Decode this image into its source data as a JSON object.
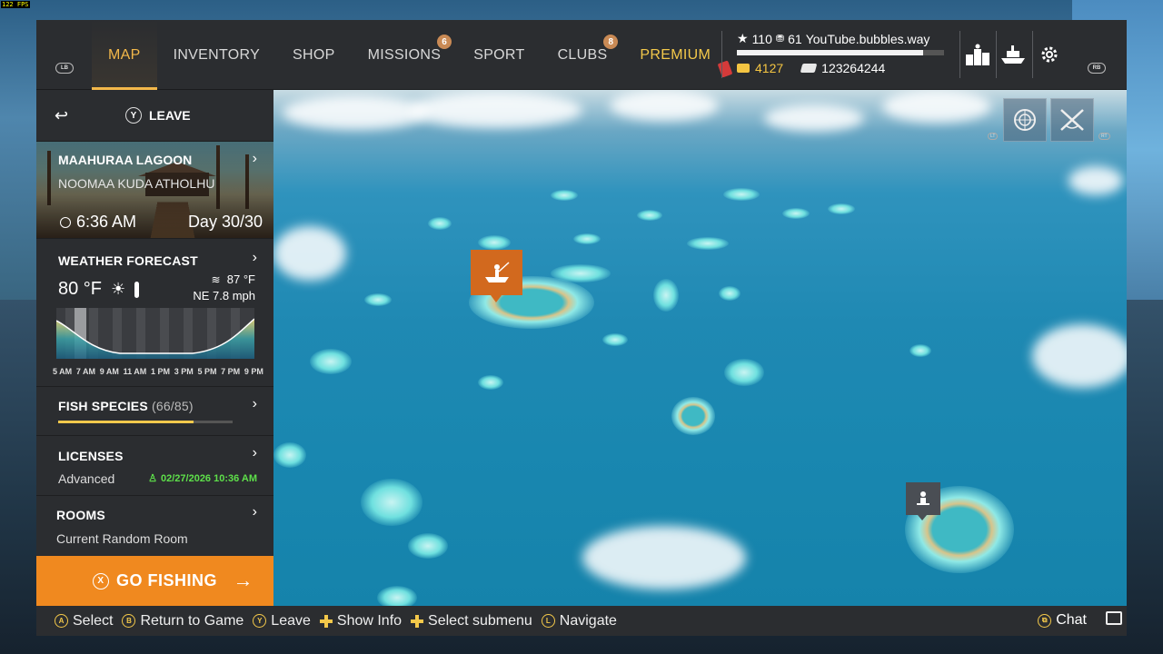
{
  "fps": "122 FPS",
  "topbar": {
    "lb": "LB",
    "rb": "RB",
    "nav": [
      {
        "label": "MAP",
        "badge": ""
      },
      {
        "label": "INVENTORY",
        "badge": ""
      },
      {
        "label": "SHOP",
        "badge": ""
      },
      {
        "label": "MISSIONS",
        "badge": "6"
      },
      {
        "label": "SPORT",
        "badge": ""
      },
      {
        "label": "CLUBS",
        "badge": "8"
      },
      {
        "label": "PREMIUM",
        "badge": ""
      }
    ],
    "player": {
      "level": "110",
      "rank": "61",
      "name": "YouTube.bubbles.way",
      "xp_progress": 0.9,
      "gold": "4127",
      "cash": "123264244"
    },
    "icons": [
      "leaderboard-icon",
      "ship-icon",
      "settings-icon"
    ]
  },
  "panel": {
    "leave_button": "Y",
    "leave_label": "LEAVE",
    "location": {
      "name": "MAAHURAA LAGOON",
      "region": "NOOMAA KUDA ATHOLHU",
      "time": "6:36 AM",
      "day": "Day 30/30"
    },
    "weather": {
      "title": "WEATHER FORECAST",
      "air_temp": "80 °F",
      "water_temp": "87 °F",
      "wind": "NE 7.8 mph",
      "hours": [
        "5 AM",
        "7 AM",
        "9 AM",
        "11 AM",
        "1 PM",
        "3 PM",
        "5 PM",
        "7 PM",
        "9 PM"
      ]
    },
    "species": {
      "title": "FISH SPECIES",
      "count": "(66/85)",
      "progress": 0.776
    },
    "licenses": {
      "title": "LICENSES",
      "value": "Advanced",
      "expiry": "02/27/2026 10:36 AM"
    },
    "rooms": {
      "title": "ROOMS",
      "value": "Current Random Room"
    },
    "go_fishing": {
      "button": "X",
      "label": "GO FISHING"
    }
  },
  "map": {
    "mini_tags": [
      "LT",
      "RT"
    ]
  },
  "bottombar": {
    "hints": [
      {
        "key": "A",
        "label": "Select"
      },
      {
        "key": "B",
        "label": "Return to Game"
      },
      {
        "key": "Y",
        "label": "Leave"
      },
      {
        "key": "dpad",
        "label": "Show Info"
      },
      {
        "key": "dpad",
        "label": "Select submenu"
      },
      {
        "key": "L",
        "label": "Navigate"
      }
    ],
    "chat": "Chat"
  },
  "colors": {
    "accent": "#f3b84a",
    "go_fishing": "#f0891f",
    "license_valid": "#5ee04a",
    "marker": "#d2691e"
  }
}
